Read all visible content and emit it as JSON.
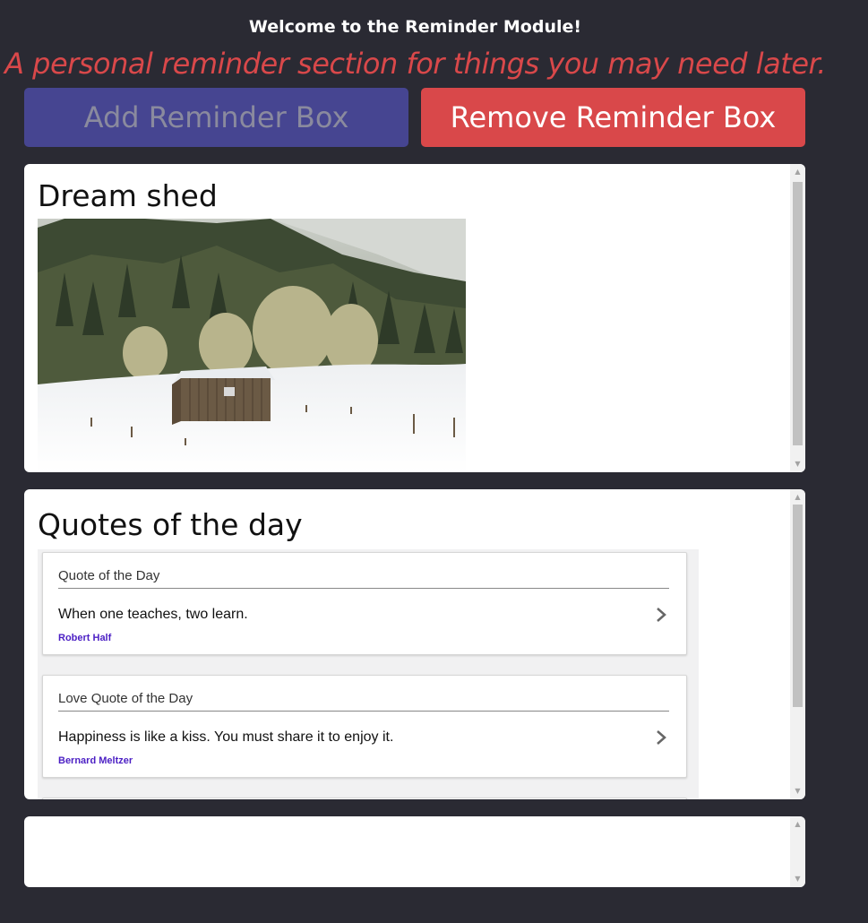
{
  "header": {
    "title": "Welcome to the Reminder Module!",
    "subtitle": "A personal reminder section for things you may need later."
  },
  "buttons": {
    "add_label": "Add Reminder Box",
    "remove_label": "Remove Reminder Box"
  },
  "colors": {
    "background": "#2a2a33",
    "accent_red": "#d9484a",
    "accent_blue": "#464591",
    "author_link": "#4b1fc4"
  },
  "boxes": [
    {
      "heading": "Dream shed",
      "image_icon": "snowy-shed-photo"
    },
    {
      "heading": "Quotes of the day",
      "quotes": [
        {
          "category": "Quote of the Day",
          "text": "When one teaches, two learn.",
          "author": "Robert Half"
        },
        {
          "category": "Love Quote of the Day",
          "text": "Happiness is like a kiss. You must share it to enjoy it.",
          "author": "Bernard Meltzer"
        }
      ]
    },
    {
      "heading": ""
    }
  ]
}
